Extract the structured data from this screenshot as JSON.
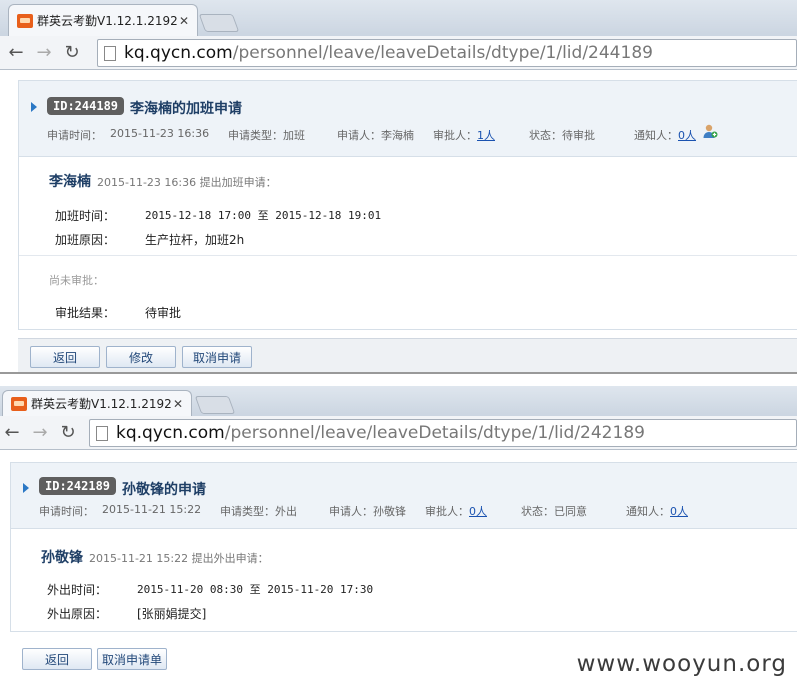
{
  "screen1": {
    "tab_title": "群英云考勤V1.12.1.2192",
    "url_host": "kq.qycn.com",
    "url_path": "/personnel/leave/leaveDetails/dtype/1/lid/244189",
    "id_badge": "ID:244189",
    "title": "李海楠的加班申请",
    "meta": {
      "apply_time_label": "申请时间：",
      "apply_time": "2015-11-23 16:36",
      "type_label": "申请类型：",
      "type": "加班",
      "applicant_label": "申请人：",
      "applicant": "李海楠",
      "approver_label": "审批人：",
      "approver": "1人",
      "status_label": "状态：",
      "status": "待审批",
      "notify_label": "通知人：",
      "notify": "0人"
    },
    "applicant_name": "李海楠",
    "submit_line": "2015-11-23 16:36  提出加班申请：",
    "fields": [
      {
        "label": "加班时间：",
        "value": "2015-12-18 17:00 至 2015-12-18 19:01"
      },
      {
        "label": "加班原因：",
        "value": "生产拉杆，加班2h"
      }
    ],
    "pending_label": "尚未审批：",
    "result_label": "审批结果：",
    "result_value": "待审批",
    "buttons": [
      "返回",
      "修改",
      "取消申请"
    ]
  },
  "screen2": {
    "tab_title": "群英云考勤V1.12.1.2192",
    "url_host": "kq.qycn.com",
    "url_path": "/personnel/leave/leaveDetails/dtype/1/lid/242189",
    "id_badge": "ID:242189",
    "title": "孙敬锋的申请",
    "meta": {
      "apply_time_label": "申请时间：",
      "apply_time": "2015-11-21 15:22",
      "type_label": "申请类型：",
      "type": "外出",
      "applicant_label": "申请人：",
      "applicant": "孙敬锋",
      "approver_label": "审批人：",
      "approver": "0人",
      "status_label": "状态：",
      "status": "已同意",
      "notify_label": "通知人：",
      "notify": "0人"
    },
    "applicant_name": "孙敬锋",
    "submit_line": "2015-11-21 15:22  提出外出申请：",
    "fields": [
      {
        "label": "外出时间：",
        "value": "2015-11-20 08:30 至 2015-11-20 17:30"
      },
      {
        "label": "外出原因：",
        "value": "[张丽娟提交]"
      }
    ],
    "buttons": [
      "返回",
      "取消申请单"
    ]
  },
  "watermark": "www.wooyun.org",
  "colors": {
    "accent": "#2b78c5",
    "title": "#1f3f66",
    "link": "#1a52b0",
    "badge": "#5f5f5f"
  }
}
